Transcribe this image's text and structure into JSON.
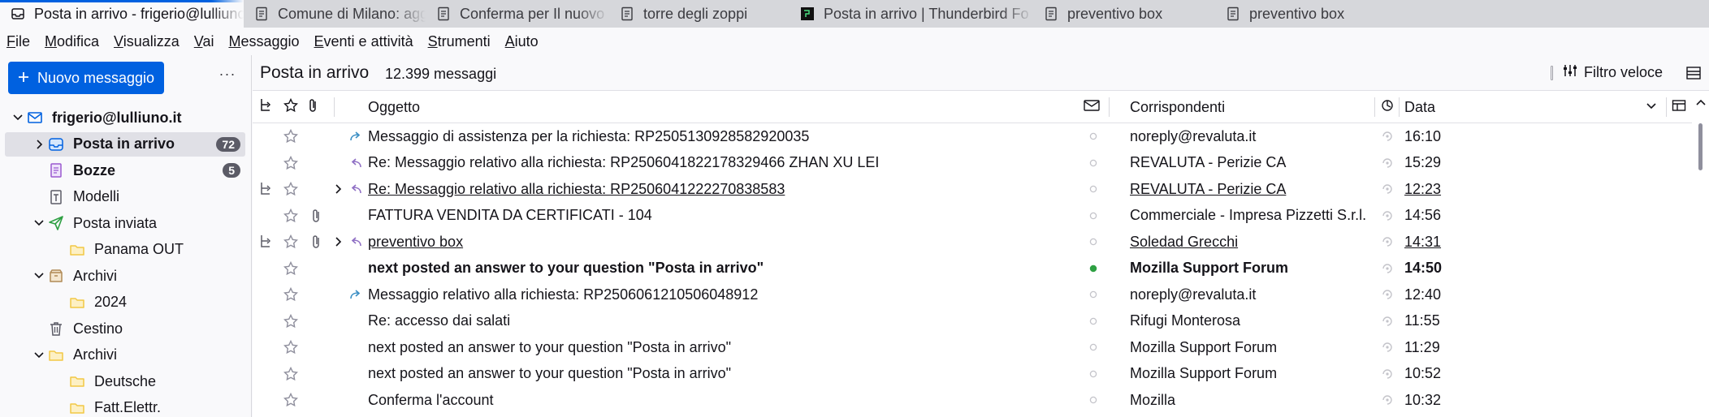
{
  "tabs": [
    {
      "label": "Posta in arrivo - frigerio@lulliuno.it",
      "icon": "mail-tab-icon",
      "active": true
    },
    {
      "label": "Comune di Milano: aggiornato i",
      "icon": "message-tab-icon"
    },
    {
      "label": "Conferma per Il nuovo codice d",
      "icon": "message-tab-icon"
    },
    {
      "label": "torre degli zoppi",
      "icon": "message-tab-icon"
    },
    {
      "label": "Posta in arrivo | Thunderbird Fo",
      "icon": "web-tab-icon"
    },
    {
      "label": "preventivo box",
      "icon": "message-tab-icon"
    },
    {
      "label": "preventivo box",
      "icon": "message-tab-icon"
    }
  ],
  "menubar": [
    {
      "u": "F",
      "rest": "ile"
    },
    {
      "u": "M",
      "rest": "odifica"
    },
    {
      "u": "V",
      "rest": "isualizza"
    },
    {
      "u": "V",
      "rest": "ai"
    },
    {
      "u": "M",
      "rest": "essaggio"
    },
    {
      "u": "E",
      "rest": "venti e attività"
    },
    {
      "u": "S",
      "rest": "trumenti"
    },
    {
      "u": "A",
      "rest": "iuto"
    }
  ],
  "folderpane": {
    "new_message_label": "Nuovo messaggio",
    "more_label": "···",
    "folders": [
      {
        "name": "frigerio@lulliuno.it",
        "icon": "mail-account-icon",
        "level": 0,
        "twisty": "open",
        "bold": true
      },
      {
        "name": "Posta in arrivo",
        "icon": "inbox-icon",
        "level": 1,
        "twisty": "closed",
        "bold": true,
        "badge": "72",
        "selected": true
      },
      {
        "name": "Bozze",
        "icon": "drafts-icon",
        "level": 1,
        "bold": true,
        "badge": "5"
      },
      {
        "name": "Modelli",
        "icon": "templates-icon",
        "level": 1
      },
      {
        "name": "Posta inviata",
        "icon": "sent-icon",
        "level": 1,
        "twisty": "open"
      },
      {
        "name": "Panama OUT",
        "icon": "folder-icon",
        "level": 2
      },
      {
        "name": "Archivi",
        "icon": "archive-icon",
        "level": 1,
        "twisty": "open"
      },
      {
        "name": "2024",
        "icon": "folder-icon",
        "level": 2
      },
      {
        "name": "Cestino",
        "icon": "trash-icon",
        "level": 1
      },
      {
        "name": "Archivi",
        "icon": "folder-icon",
        "level": 1,
        "twisty": "open"
      },
      {
        "name": "Deutsche",
        "icon": "folder-icon",
        "level": 2
      },
      {
        "name": "Fatt.Elettr.",
        "icon": "folder-icon",
        "level": 2
      }
    ]
  },
  "header": {
    "folder_title": "Posta in arrivo",
    "message_count": "12.399 messaggi",
    "quick_filter_label": "Filtro veloce"
  },
  "columns": {
    "subject": "Oggetto",
    "correspondents": "Corrispondenti",
    "date": "Data"
  },
  "messages": [
    {
      "subject": "Messaggio di assistenza per la richiesta: RP2505130928582920035",
      "correspondent": "noreply@revaluta.it",
      "date": "16:10",
      "status": "forwarded",
      "unread": false,
      "thread": false,
      "attachment": false,
      "twisty": false,
      "dot": "grey"
    },
    {
      "subject": "Re: Messaggio relativo alla richiesta: RP2506041822178329466 ZHAN XU LEI",
      "correspondent": "REVALUTA - Perizie CA",
      "date": "15:29",
      "status": "replied",
      "unread": false,
      "thread": false,
      "attachment": false,
      "twisty": false,
      "dot": "grey"
    },
    {
      "subject": "Re: Messaggio relativo alla richiesta: RP2506041222270838583",
      "correspondent": "REVALUTA - Perizie CA",
      "date": "12:23",
      "status": "replied",
      "unread": false,
      "thread": true,
      "attachment": false,
      "twisty": true,
      "dot": "grey"
    },
    {
      "subject": "FATTURA VENDITA DA CERTIFICATI - 104",
      "correspondent": "Commerciale - Impresa Pizzetti S.r.l.",
      "date": "14:56",
      "status": "",
      "unread": false,
      "thread": false,
      "attachment": true,
      "twisty": false,
      "dot": "grey"
    },
    {
      "subject": "preventivo box",
      "correspondent": "Soledad Grecchi",
      "date": "14:31",
      "status": "replied",
      "unread": false,
      "thread": true,
      "attachment": true,
      "twisty": true,
      "dot": "grey"
    },
    {
      "subject": "next posted an answer to your question \"Posta in arrivo\"",
      "correspondent": "Mozilla Support Forum",
      "date": "14:50",
      "status": "",
      "unread": true,
      "thread": false,
      "attachment": false,
      "twisty": false,
      "dot": "green"
    },
    {
      "subject": "Messaggio relativo alla richiesta: RP2506061210506048912",
      "correspondent": "noreply@revaluta.it",
      "date": "12:40",
      "status": "forwarded",
      "unread": false,
      "thread": false,
      "attachment": false,
      "twisty": false,
      "dot": "grey"
    },
    {
      "subject": "Re: accesso dai salati",
      "correspondent": "Rifugi Monterosa",
      "date": "11:55",
      "status": "",
      "unread": false,
      "thread": false,
      "attachment": false,
      "twisty": false,
      "dot": "grey"
    },
    {
      "subject": "next posted an answer to your question \"Posta in arrivo\"",
      "correspondent": "Mozilla Support Forum",
      "date": "11:29",
      "status": "",
      "unread": false,
      "thread": false,
      "attachment": false,
      "twisty": false,
      "dot": "grey"
    },
    {
      "subject": "next posted an answer to your question \"Posta in arrivo\"",
      "correspondent": "Mozilla Support Forum",
      "date": "10:52",
      "status": "",
      "unread": false,
      "thread": false,
      "attachment": false,
      "twisty": false,
      "dot": "grey"
    },
    {
      "subject": "Conferma l'account",
      "correspondent": "Mozilla",
      "date": "10:32",
      "status": "",
      "unread": false,
      "thread": false,
      "attachment": false,
      "twisty": false,
      "dot": "grey"
    }
  ],
  "colors": {
    "accent": "#0061e0",
    "reply_arrow": "#8f6fc4",
    "forward_arrow": "#3a8ec4",
    "unread_dot": "#2ea043",
    "read_dot": "#c4c4ca",
    "folder_yellow": "#f2c744",
    "badge": "#5b5b66"
  }
}
